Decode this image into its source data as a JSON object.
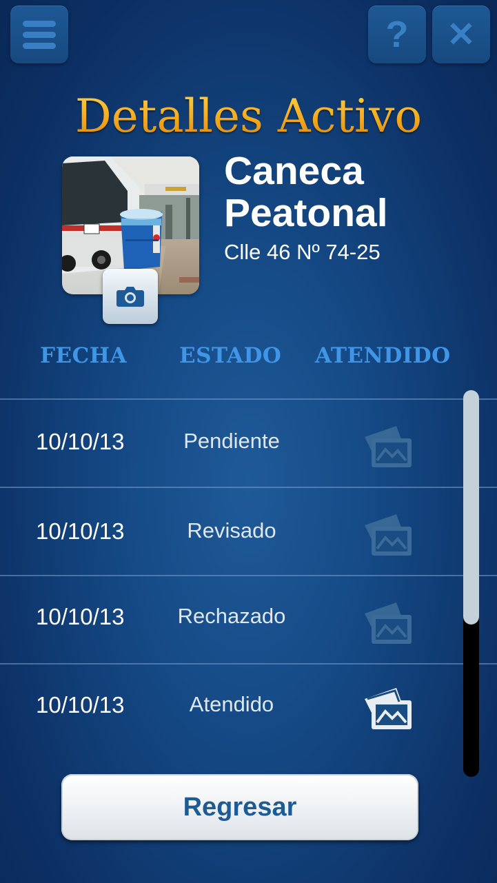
{
  "header": {
    "menu_icon": "hamburger-menu-icon",
    "help_icon": "question-mark-icon",
    "help_glyph": "?",
    "close_icon": "close-x-icon",
    "close_glyph": "✕"
  },
  "title": "Detalles Activo",
  "asset": {
    "name_line1": "Caneca",
    "name_line2": "Peatonal",
    "address": "Clle 46 Nº 74-25",
    "camera_icon": "camera-icon"
  },
  "table": {
    "headers": {
      "fecha": "FECHA",
      "estado": "ESTADO",
      "atendido": "ATENDIDO"
    },
    "rows": [
      {
        "fecha": "10/10/13",
        "estado": "Pendiente",
        "icon": "photos-icon",
        "active": false
      },
      {
        "fecha": "10/10/13",
        "estado": "Revisado",
        "icon": "photos-icon",
        "active": false
      },
      {
        "fecha": "10/10/13",
        "estado": "Rechazado",
        "icon": "photos-icon",
        "active": false
      },
      {
        "fecha": "10/10/13",
        "estado": "Atendido",
        "icon": "photos-icon",
        "active": true
      }
    ]
  },
  "footer": {
    "back_label": "Regresar"
  },
  "colors": {
    "title_gold": "#f4a91e",
    "header_blue": "#3f95e6",
    "bg_blue": "#154a86"
  }
}
